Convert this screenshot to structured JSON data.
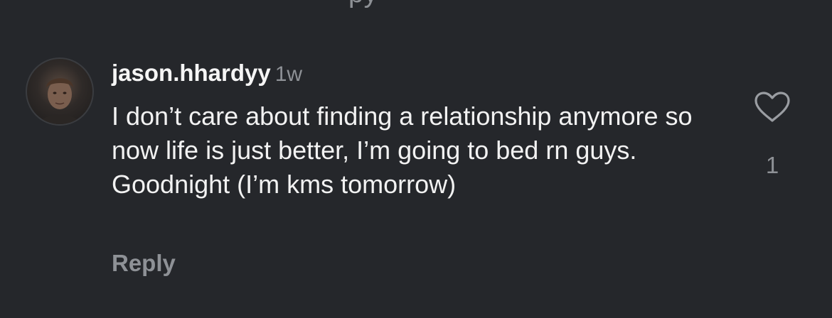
{
  "top_fragment": "py",
  "comment": {
    "username": "jason.hhardyy",
    "time": "1w",
    "text": "I don’t care about finding a relationship anymore so now life is just better, I’m going to bed rn guys. Goodnight (I’m kms tomorrow)",
    "reply_label": "Reply",
    "like_count": "1",
    "avatar_icon": "user-photo-avatar",
    "like_icon": "heart-outline-icon"
  },
  "colors": {
    "background": "#25272b",
    "primary_text": "#f2f2f2",
    "secondary_text": "#8e9196"
  }
}
